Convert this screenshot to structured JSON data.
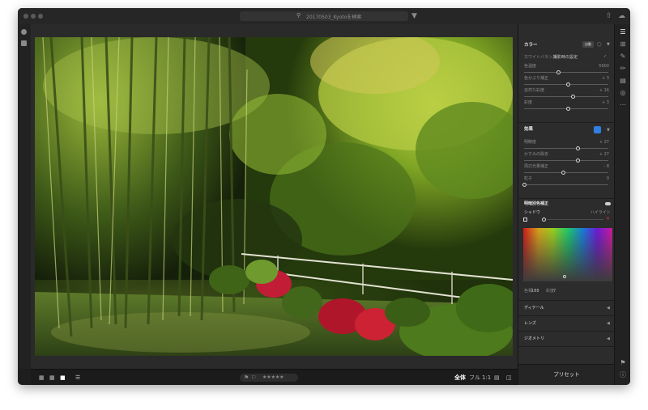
{
  "titlebar": {
    "search_text": "20170503_Kyotoを検索"
  },
  "colors": {
    "accent": "#2f7fe0",
    "panel_bg": "#2c2c2c",
    "canvas_bg": "#2a2a2a"
  },
  "panel": {
    "color_section": {
      "title": "カラー",
      "auto_label": "自動",
      "wb_label": "ホワイトバランス",
      "wb_value": "撮影時の設定",
      "sliders": [
        {
          "label": "色温度",
          "value": "5600",
          "level": 0.4
        },
        {
          "label": "色かぶり補正",
          "value": "+ 3",
          "level": 0.52
        },
        {
          "label": "自然な彩度",
          "value": "+ 16",
          "level": 0.58
        },
        {
          "label": "彩度",
          "value": "+ 3",
          "level": 0.52
        }
      ]
    },
    "effects_section": {
      "title": "効果",
      "sliders": [
        {
          "label": "明瞭度",
          "value": "+ 27",
          "level": 0.63
        },
        {
          "label": "かすみの除去",
          "value": "+ 27",
          "level": 0.63
        },
        {
          "label": "周辺光量補正",
          "value": "- 8",
          "level": 0.46
        },
        {
          "label": "粒子",
          "value": "0",
          "level": 0.0
        }
      ]
    },
    "split_toning": {
      "title": "明暗別色補正",
      "tab_shadow": "シャドウ",
      "tab_highlight": "ハイライト",
      "hue_label": "色相",
      "hue_value": "188",
      "sat_label": "彩度",
      "sat_value": "7"
    },
    "collapsed_sections": [
      "ディテール",
      "レンズ",
      "ジオメトリ"
    ],
    "presets_label": "プリセット"
  },
  "bottombar": {
    "view_full": "全体",
    "view_fill": "フル",
    "view_ratio": "1:1",
    "stars": "★ ★ ★ ★ ★"
  }
}
